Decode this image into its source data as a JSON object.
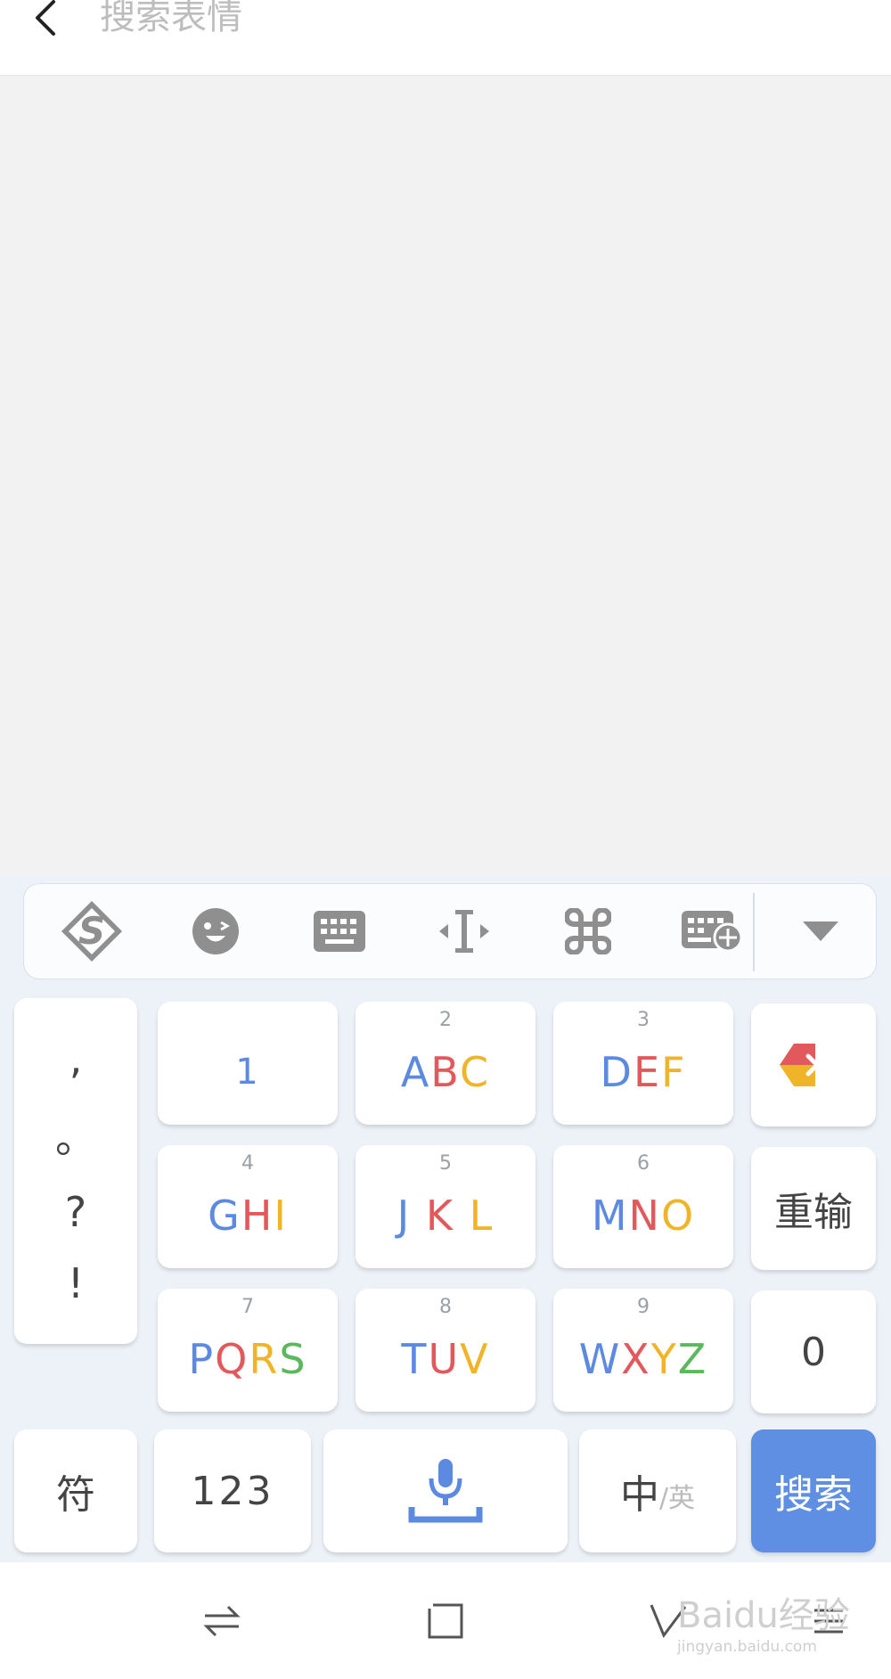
{
  "header": {
    "search_placeholder": "搜索表情",
    "back_icon": "back-arrow-icon"
  },
  "toolbar": {
    "items": [
      {
        "name": "sogou-logo-icon"
      },
      {
        "name": "emoji-icon"
      },
      {
        "name": "keyboard-icon"
      },
      {
        "name": "cursor-move-icon"
      },
      {
        "name": "command-icon"
      },
      {
        "name": "keyboard-settings-icon"
      },
      {
        "name": "collapse-icon"
      }
    ]
  },
  "keyboard": {
    "punctuation": [
      ",",
      "。",
      "?",
      "!"
    ],
    "keys": [
      {
        "num": "",
        "letters": "1"
      },
      {
        "num": "2",
        "letters": "ABC"
      },
      {
        "num": "3",
        "letters": "DEF"
      },
      {
        "num": "4",
        "letters": "GHI"
      },
      {
        "num": "5",
        "letters": "J K L"
      },
      {
        "num": "6",
        "letters": "MNO"
      },
      {
        "num": "7",
        "letters": "PQRS"
      },
      {
        "num": "8",
        "letters": "TUV"
      },
      {
        "num": "9",
        "letters": "WXYZ"
      }
    ],
    "reenter_label": "重输",
    "zero_label": "0",
    "symbol_label": "符",
    "numeric_label": "123",
    "lang_primary": "中",
    "lang_secondary": "/英",
    "search_label": "搜索",
    "delete_icon": "delete-icon",
    "mic_icon": "microphone-icon"
  },
  "navbar": {
    "items": [
      "switch-icon",
      "home-square-icon",
      "back-nav-icon",
      "menu-icon"
    ]
  },
  "watermark": {
    "line1": "Baidu经验",
    "line2": "jingyan.baidu.com"
  },
  "colors": {
    "search_key": "#5f8fe3",
    "blue": "#5b8ae0",
    "red": "#e2595b",
    "yellow": "#f0b429",
    "green": "#5cb85c"
  }
}
